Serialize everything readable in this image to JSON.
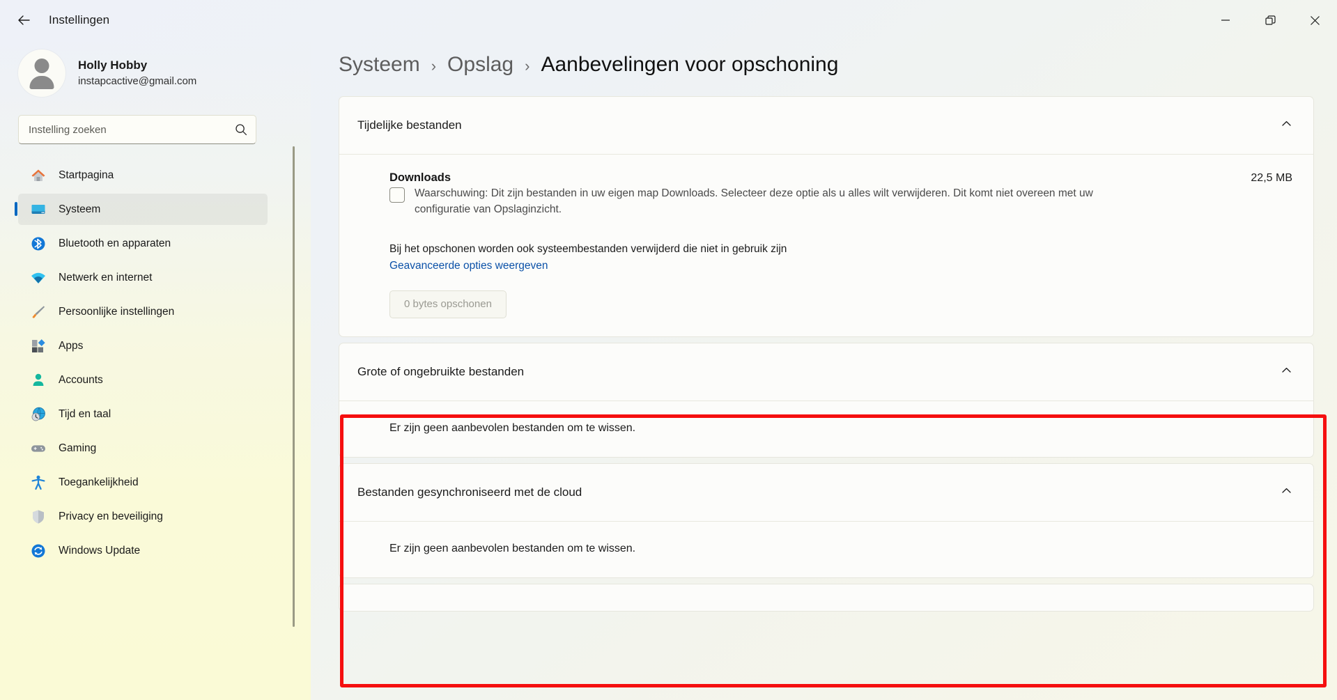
{
  "window": {
    "app_title": "Instellingen",
    "back_icon": "back-arrow-icon",
    "minimize_label": "—",
    "maximize_label": "restore-icon",
    "close_label": "✕"
  },
  "sidebar": {
    "profile": {
      "name": "Holly Hobby",
      "email": "instapcactive@gmail.com"
    },
    "search": {
      "placeholder": "Instelling zoeken",
      "value": "",
      "icon": "search-icon"
    },
    "items": [
      {
        "label": "Startpagina",
        "icon": "home-icon",
        "selected": false
      },
      {
        "label": "Systeem",
        "icon": "system-icon",
        "selected": true
      },
      {
        "label": "Bluetooth en apparaten",
        "icon": "bluetooth-icon",
        "selected": false
      },
      {
        "label": "Netwerk en internet",
        "icon": "wifi-icon",
        "selected": false
      },
      {
        "label": "Persoonlijke instellingen",
        "icon": "brush-icon",
        "selected": false
      },
      {
        "label": "Apps",
        "icon": "apps-icon",
        "selected": false
      },
      {
        "label": "Accounts",
        "icon": "account-icon",
        "selected": false
      },
      {
        "label": "Tijd en taal",
        "icon": "time-language-icon",
        "selected": false
      },
      {
        "label": "Gaming",
        "icon": "gamepad-icon",
        "selected": false
      },
      {
        "label": "Toegankelijkheid",
        "icon": "accessibility-icon",
        "selected": false
      },
      {
        "label": "Privacy en beveiliging",
        "icon": "shield-icon",
        "selected": false
      },
      {
        "label": "Windows Update",
        "icon": "update-icon",
        "selected": false
      }
    ]
  },
  "breadcrumb": {
    "parent": "Systeem",
    "separator": "›",
    "middle": "Opslag",
    "current": "Aanbevelingen voor opschoning"
  },
  "sections": {
    "temp": {
      "title": "Tijdelijke bestanden",
      "chevron": "chevron-up-icon",
      "download_title": "Downloads",
      "download_size": "22,5 MB",
      "checkbox_checked": false,
      "warning": "Waarschuwing: Dit zijn bestanden in uw eigen map Downloads. Selecteer deze optie als u alles wilt verwijderen. Dit komt niet overeen met uw configuratie van Opslaginzicht.",
      "note": "Bij het opschonen worden ook systeembestanden verwijderd die niet in gebruik zijn",
      "link": "Geavanceerde opties weergeven",
      "clean_button": "0 bytes opschonen"
    },
    "large": {
      "title": "Grote of ongebruikte bestanden",
      "chevron": "chevron-up-icon",
      "empty": "Er zijn geen aanbevolen bestanden om te wissen."
    },
    "cloud": {
      "title": "Bestanden gesynchroniseerd met de cloud",
      "chevron": "chevron-up-icon",
      "empty": "Er zijn geen aanbevolen bestanden om te wissen."
    }
  },
  "annotation": {
    "highlight_color": "#f50f0f"
  }
}
